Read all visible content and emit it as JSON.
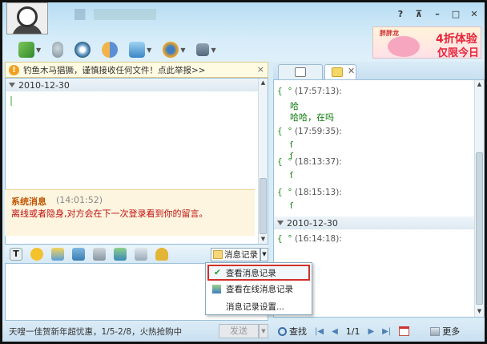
{
  "header": {
    "window_buttons": [
      "?",
      "⊼",
      "–",
      "□",
      "✕"
    ],
    "toolbar_icons": [
      "transfer-file-icon",
      "voice-icon",
      "video-icon",
      "group-icon",
      "remote-assist-icon",
      "apps-icon"
    ]
  },
  "ad": {
    "brand": "胖胖龙",
    "title": "4折体验",
    "subtitle": "仅限今日"
  },
  "warning": {
    "text": "钓鱼木马猖獗，谨慎接收任何文件！点此举报>>",
    "close": "×"
  },
  "left_chat": {
    "date": "2010-12-30",
    "system_message": {
      "title": "系统消息",
      "time": "(14:01:52)",
      "body": "离线或者隐身,对方会在下一次登录看到你的留言。"
    }
  },
  "input_toolbar": {
    "icons": [
      "font-icon",
      "emoji-icon",
      "shake-icon",
      "screenshot-icon",
      "music-icon",
      "image-icon",
      "more-icon",
      "bell-icon"
    ],
    "message_record_label": "消息记录"
  },
  "menu": {
    "items": [
      {
        "label": "查看消息记录",
        "icon": "checkmark-icon",
        "highlighted": true
      },
      {
        "label": "查看在线消息记录",
        "icon": "online-record-icon",
        "highlighted": false
      },
      {
        "label": "消息记录设置...",
        "icon": "",
        "highlighted": false
      }
    ]
  },
  "bottom": {
    "promo": "天嗖一佳贺新年超忧惠，1/5-2/8，火热抢购中",
    "send_label": "发送"
  },
  "right_chat": {
    "entries": [
      {
        "time": "(17:57:13):",
        "lines": [
          "哈",
          "哈哈，在吗"
        ]
      },
      {
        "time": "(17:59:35):",
        "lines": [
          "",
          ""
        ]
      },
      {
        "time": "(18:13:37):",
        "lines": [
          ""
        ]
      },
      {
        "time": "(18:15:13):",
        "lines": [
          ""
        ]
      }
    ],
    "date": "2010-12-30",
    "last_time": "(16:14:18):"
  },
  "right_bottom": {
    "search_label": "查找",
    "page": "1/1",
    "more_label": "更多"
  }
}
